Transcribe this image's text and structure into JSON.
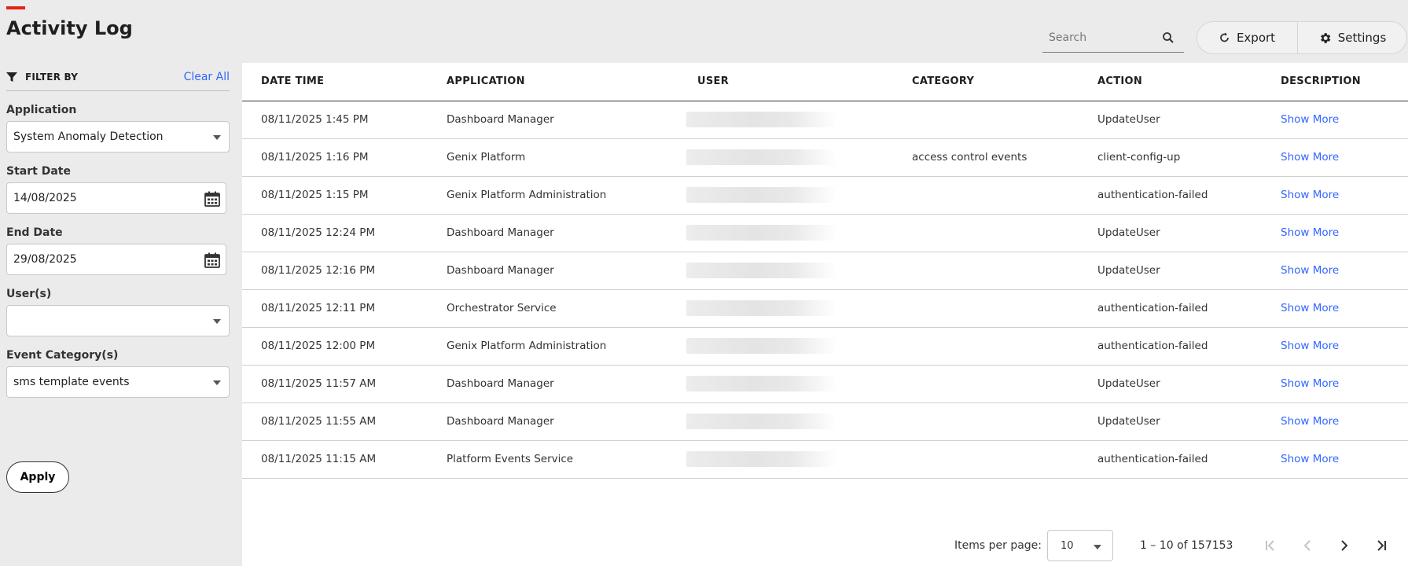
{
  "page": {
    "title": "Activity Log",
    "accent_color": "#e2231a"
  },
  "search": {
    "placeholder": "Search"
  },
  "toolbar": {
    "export_label": "Export",
    "settings_label": "Settings"
  },
  "sidebar": {
    "filter_label": "FILTER BY",
    "clear_all": "Clear All",
    "application": {
      "label": "Application",
      "value": "System Anomaly Detection"
    },
    "start_date": {
      "label": "Start Date",
      "value": "14/08/2025"
    },
    "end_date": {
      "label": "End Date",
      "value": "29/08/2025"
    },
    "users": {
      "label": "User(s)",
      "value": ""
    },
    "event_category": {
      "label": "Event Category(s)",
      "value": "sms template events"
    },
    "apply_label": "Apply"
  },
  "table": {
    "columns": [
      "DATE TIME",
      "APPLICATION",
      "USER",
      "CATEGORY",
      "ACTION",
      "DESCRIPTION"
    ],
    "rows": [
      {
        "datetime": "08/11/2025 1:45 PM",
        "application": "Dashboard Manager",
        "category": "",
        "action": "UpdateUser",
        "description": "Show More"
      },
      {
        "datetime": "08/11/2025 1:16 PM",
        "application": "Genix Platform",
        "category": "access control events",
        "action": "client-config-up",
        "description": "Show More"
      },
      {
        "datetime": "08/11/2025 1:15 PM",
        "application": "Genix Platform Administration",
        "category": "",
        "action": "authentication-failed",
        "description": "Show More"
      },
      {
        "datetime": "08/11/2025 12:24 PM",
        "application": "Dashboard Manager",
        "category": "",
        "action": "UpdateUser",
        "description": "Show More"
      },
      {
        "datetime": "08/11/2025 12:16 PM",
        "application": "Dashboard Manager",
        "category": "",
        "action": "UpdateUser",
        "description": "Show More"
      },
      {
        "datetime": "08/11/2025 12:11 PM",
        "application": "Orchestrator Service",
        "category": "",
        "action": "authentication-failed",
        "description": "Show More"
      },
      {
        "datetime": "08/11/2025 12:00 PM",
        "application": "Genix Platform Administration",
        "category": "",
        "action": "authentication-failed",
        "description": "Show More"
      },
      {
        "datetime": "08/11/2025 11:57 AM",
        "application": "Dashboard Manager",
        "category": "",
        "action": "UpdateUser",
        "description": "Show More"
      },
      {
        "datetime": "08/11/2025 11:55 AM",
        "application": "Dashboard Manager",
        "category": "",
        "action": "UpdateUser",
        "description": "Show More"
      },
      {
        "datetime": "08/11/2025 11:15 AM",
        "application": "Platform Events Service",
        "category": "",
        "action": "authentication-failed",
        "description": "Show More"
      }
    ]
  },
  "paginator": {
    "items_label": "Items per page:",
    "page_size": "10",
    "range": "1 – 10 of 157153"
  },
  "colors": {
    "link": "#3366ff",
    "background": "#ebebeb",
    "panel": "#ffffff"
  }
}
